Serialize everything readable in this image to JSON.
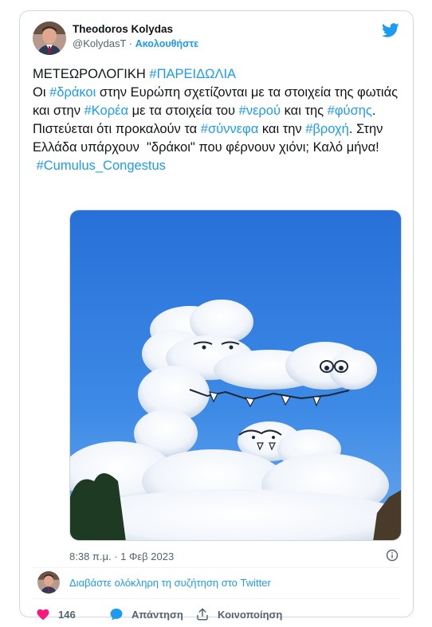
{
  "author": {
    "display_name": "Theodoros Kolydas",
    "handle": "@KolydasT",
    "separator": " · ",
    "follow_label": "Ακολουθήστε"
  },
  "tweet": {
    "line1_text": "ΜΕΤΕΩΡΟΛΟΓΙΚΗ ",
    "line1_tag": "#ΠΑΡΕΙΔΩΛΙΑ",
    "t_oi": "Οι ",
    "tag_drakoi": "#δράκοι",
    "t_europe": " στην Ευρώπη σχετίζονται με τα στοιχεία της φωτιάς και στην ",
    "tag_korea": "#Κορέα",
    "t_elements": " με τα στοιχεία του ",
    "tag_nerou": "#νερού",
    "t_kai": " και της ",
    "tag_fysis": "#φύσης",
    "t_believed": ". Πιστεύεται ότι προκαλούν τα ",
    "tag_synnefa": "#σύννεφα",
    "t_kai_tin": " και την ",
    "tag_vroxi": "#βροχή",
    "t_greece": ". Στην Ελλάδα υπάρχουν  \"δράκοι\" που φέρνουν χιόνι; Καλό μήνα!",
    "tag_cumulus": "#Cumulus_Congestus",
    "timestamp": "8:38 π.μ. · 1 Φεβ 2023"
  },
  "conversation": {
    "link_label": "Διαβάστε ολόκληρη τη συζήτηση στο Twitter"
  },
  "actions": {
    "like_count": "146",
    "reply_label": "Απάντηση",
    "share_label": "Κοινοποίηση"
  },
  "icons": {
    "brand": "twitter-bird-icon",
    "info": "info-icon",
    "like": "heart-icon",
    "reply": "reply-bubble-icon",
    "share": "share-icon"
  },
  "colors": {
    "accent": "#1d9bf0",
    "like": "#f91880",
    "text": "#0f1419",
    "secondary": "#536471",
    "border": "#cfd9de",
    "sky": "#2f7ee0"
  }
}
